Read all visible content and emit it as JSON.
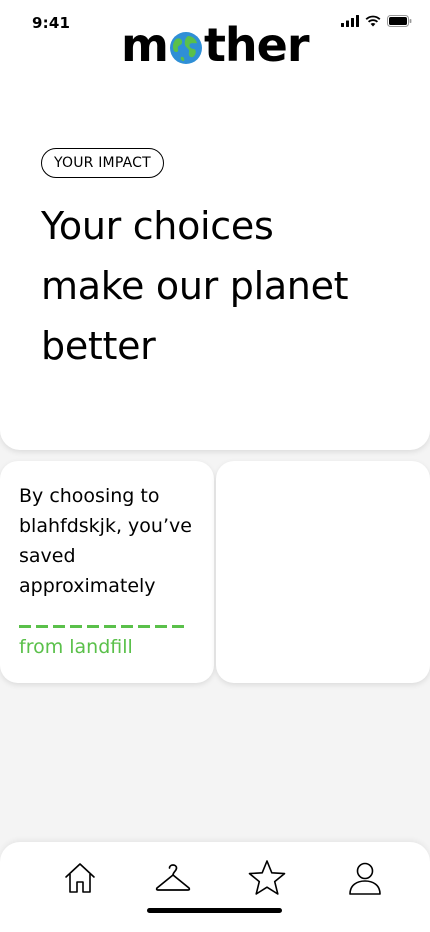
{
  "status_bar": {
    "time": "9:41"
  },
  "app": {
    "logo_left": "m",
    "logo_right": "ther"
  },
  "hero": {
    "badge": "YOUR IMPACT",
    "headline_lines": [
      "Your choices",
      "make our planet",
      "better"
    ]
  },
  "impact_card": {
    "lines": [
      "By choosing to",
      "blahfdskjk, you’ve",
      "saved",
      "approximately"
    ],
    "highlight": "from landfill"
  },
  "colors": {
    "accent_green": "#5ac04a",
    "globe_blue": "#2f8fd6",
    "globe_green": "#5ac04a"
  },
  "nav": {
    "items": [
      {
        "icon": "home-icon"
      },
      {
        "icon": "hanger-icon"
      },
      {
        "icon": "star-icon"
      },
      {
        "icon": "profile-icon"
      }
    ]
  }
}
